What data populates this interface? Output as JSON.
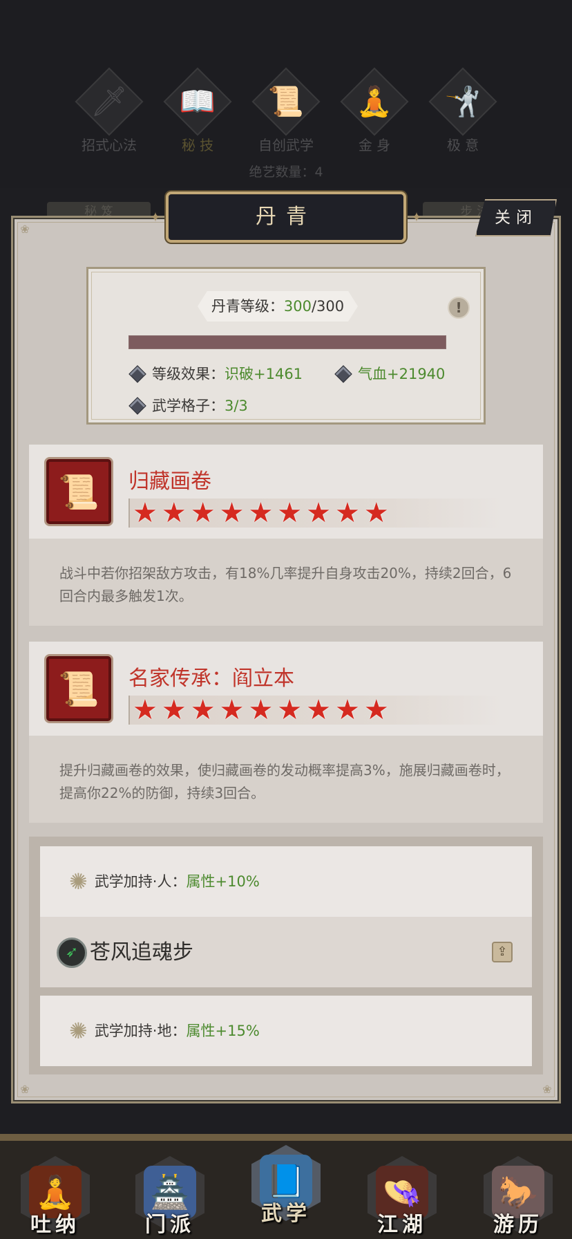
{
  "top_tabs": [
    {
      "label": "招式心法",
      "icon": "sword-icon"
    },
    {
      "label": "秘 技",
      "icon": "book-icon",
      "active": true
    },
    {
      "label": "自创武学",
      "icon": "scroll-icon"
    },
    {
      "label": "金 身",
      "icon": "meditation-icon"
    },
    {
      "label": "极 意",
      "icon": "martial-pose-icon"
    }
  ],
  "count_text": "绝艺数量：4",
  "behind_tab_left": "秘 笈",
  "behind_tab_right": "步 法",
  "panel": {
    "title": "丹青",
    "close_label": "关闭"
  },
  "level": {
    "label_prefix": "丹青等级：",
    "current": "300",
    "max": "/300",
    "progress": 1.0,
    "effect_label": "等级效果：",
    "effect_value_1": "识破+1461",
    "effect_value_2": "气血+21940",
    "slots_label": "武学格子：",
    "slots_value": "3/3"
  },
  "skills": [
    {
      "name": "归藏画卷",
      "icon": "painting-scroll-icon",
      "stars": 9,
      "description": "战斗中若你招架敌方攻击，有18%几率提升自身攻击20%，持续2回合，6回合内最多触发1次。"
    },
    {
      "name": "名家传承：阎立本",
      "icon": "inheritance-scroll-icon",
      "stars": 9,
      "description": "提升归藏画卷的效果，使归藏画卷的发动概率提高3%，施展归藏画卷时，提高你22%的防御，持续3回合。"
    }
  ],
  "bonuses": {
    "human_label": "武学加持·人：",
    "human_value": "属性+10%",
    "move_name": "苍风追魂步",
    "earth_label": "武学加持·地：",
    "earth_value": "属性+15%"
  },
  "bottom_nav": [
    {
      "label": "吐纳",
      "icon": "meditating-figure-icon"
    },
    {
      "label": "门派",
      "icon": "sect-banner-icon"
    },
    {
      "label": "武学",
      "icon": "martial-book-icon",
      "active": true
    },
    {
      "label": "江湖",
      "icon": "bamboo-hat-icon"
    },
    {
      "label": "游历",
      "icon": "horse-icon"
    }
  ],
  "colors": {
    "accent_red": "#c0342a",
    "value_green": "#4c8a2e",
    "panel_bg": "#cbc5bf",
    "gold_border": "#c2a877"
  }
}
